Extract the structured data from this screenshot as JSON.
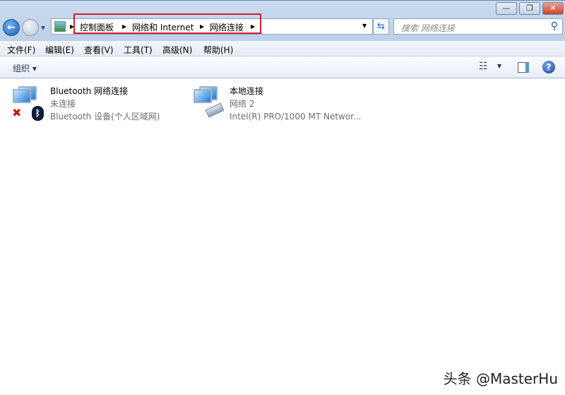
{
  "window": {
    "minimize": "—",
    "restore": "❐",
    "close": "✕"
  },
  "address": {
    "crumbs": [
      "控制面板",
      "网络和 Internet",
      "网络连接"
    ]
  },
  "search": {
    "placeholder": "搜索 网络连接"
  },
  "menu": [
    "文件(F)",
    "编辑(E)",
    "查看(V)",
    "工具(T)",
    "高级(N)",
    "帮助(H)"
  ],
  "toolbar": {
    "organize": "组织 ▾",
    "help": "?"
  },
  "connections": [
    {
      "name": "Bluetooth 网络连接",
      "status": "未连接",
      "device": "Bluetooth 设备(个人区域网)"
    },
    {
      "name": "本地连接",
      "status": "网络  2",
      "device": "Intel(R) PRO/1000 MT Networ..."
    }
  ],
  "watermark": "头条 @MasterHu"
}
